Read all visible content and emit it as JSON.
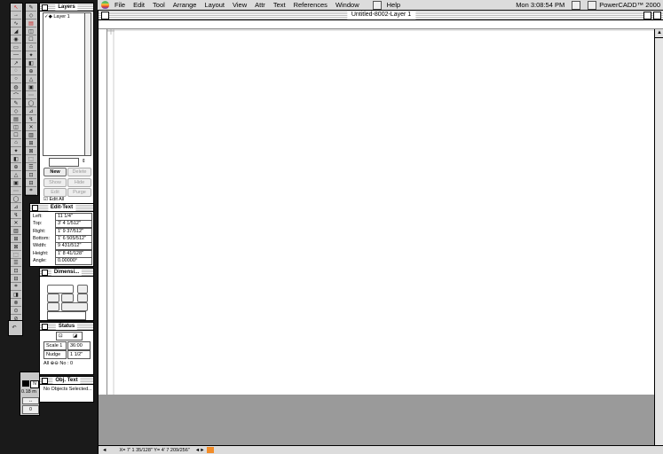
{
  "menubar": {
    "menus": [
      "File",
      "Edit",
      "Tool",
      "Arrange",
      "Layout",
      "View",
      "Attr",
      "Text",
      "References",
      "Window",
      "Help"
    ],
    "clock": "Mon 3:08:54 PM",
    "app_name": "PowerCADD™ 2000"
  },
  "document": {
    "title": "Untitled-8002-Layer 1",
    "status_coords": "X= 7' 1 35/128\"  Y= 4' 7 209/256\""
  },
  "layers": {
    "title": "Layers",
    "items": [
      "Layer 1"
    ],
    "buttons": {
      "new": "New",
      "delete": "Delete",
      "show": "Show",
      "hide": "Hide",
      "edit": "Edit",
      "purge": "Purge"
    },
    "edit_all": "Edit All"
  },
  "edit_text": {
    "title": "Edit-Text",
    "rows": [
      {
        "label": "Left:",
        "value": "11 1/4\""
      },
      {
        "label": "Top:",
        "value": "3' 4 1/512\""
      },
      {
        "label": "Right:",
        "value": "1' 9 37/512\""
      },
      {
        "label": "Bottom:",
        "value": "1' 6 505/512\""
      },
      {
        "label": "Width:",
        "value": "9 431/512\""
      },
      {
        "label": "Height:",
        "value": "1' 8 41/128\""
      },
      {
        "label": "Angle:",
        "value": "0.00000°"
      }
    ]
  },
  "dimension": {
    "title": "Dimensi..."
  },
  "status": {
    "title": "Status",
    "scale_label": "Scale",
    "scale_value": "1",
    "scale_field": "36:00",
    "nudge_label": "Nudge",
    "nudge_value": "1 1/2\"",
    "all_label": "All",
    "no_label": "No : 0"
  },
  "obj_text": {
    "title": "Obj. Text",
    "message": "No Objects Selected..."
  },
  "mini_palette": {
    "value": "0.18 m",
    "n_label": "N",
    "num": "0"
  }
}
